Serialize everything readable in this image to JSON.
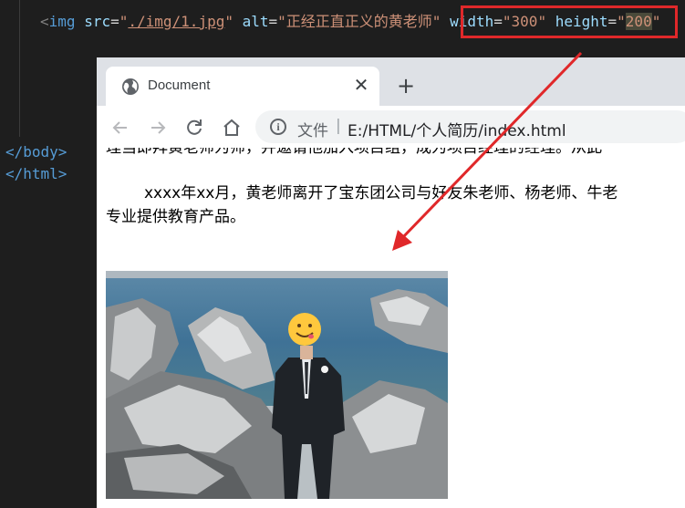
{
  "editor": {
    "code": {
      "lt": "<",
      "tag": "img",
      "src_attr": "src",
      "src_value_open": "\"",
      "src_value": "./img/1.jpg",
      "src_value_close": "\"",
      "alt_attr": "alt",
      "alt_value": "\"正经正直正义的黄老师\"",
      "width_attr": "width",
      "width_value": "\"300\"",
      "height_attr": "height",
      "height_value_open": "\"",
      "height_value": "200",
      "height_value_close": "\""
    },
    "closing_body": "</body>",
    "closing_html": "</html>"
  },
  "browser": {
    "tab_title": "Document",
    "tab_close": "✕",
    "new_tab": "+",
    "url_prefix": "文件",
    "url_separator": "|",
    "url": "E:/HTML/个人简历/index.html"
  },
  "page": {
    "para1": "理当即拜黄老师为师，并邀请他加入项目组，成为项目经理的经理。从此",
    "para2": "xxxx年xx月，黄老师离开了宝东团公司与好友朱老师、杨老师、牛老",
    "para3": "专业提供教育产品。"
  },
  "icons": {
    "favicon": "globe-icon",
    "back": "arrow-left-icon",
    "forward": "arrow-right-icon",
    "reload": "reload-icon",
    "home": "home-icon",
    "info": "info-icon"
  },
  "colors": {
    "highlight": "#e0282a",
    "editor_bg": "#1e1e1e",
    "tag": "#569cd6",
    "attr": "#9cdcfe",
    "string": "#ce9178"
  }
}
